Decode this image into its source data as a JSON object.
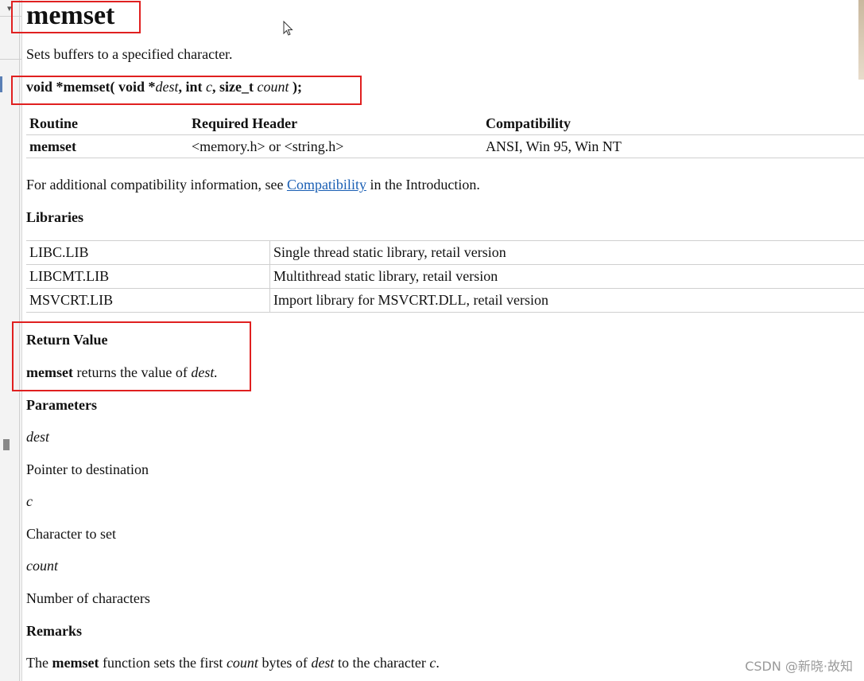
{
  "title": "memset",
  "description": "Sets buffers to a specified character.",
  "prototype": {
    "p1": "void *memset( void *",
    "dest": "dest",
    "p2": ", int ",
    "c": "c",
    "p3": ", size_t ",
    "count": "count",
    "p4": " );"
  },
  "compat_table": {
    "headers": [
      "Routine",
      "Required Header",
      "Compatibility"
    ],
    "row": [
      "memset",
      "<memory.h> or <string.h>",
      "ANSI, Win 95, Win NT"
    ]
  },
  "additional": {
    "before": "For additional compatibility information, see ",
    "link": "Compatibility",
    "after": " in the Introduction."
  },
  "libraries": {
    "heading": "Libraries",
    "rows": [
      [
        "LIBC.LIB",
        "Single thread static library, retail version"
      ],
      [
        "LIBCMT.LIB",
        "Multithread static library, retail version"
      ],
      [
        "MSVCRT.LIB",
        "Import library for MSVCRT.DLL, retail version"
      ]
    ]
  },
  "return_value": {
    "heading": "Return Value",
    "name": "memset",
    "text": " returns the value of ",
    "param": "dest."
  },
  "parameters": {
    "heading": "Parameters",
    "items": [
      {
        "name": "dest",
        "desc": "Pointer to destination"
      },
      {
        "name": "c",
        "desc": "Character to set"
      },
      {
        "name": "count",
        "desc": "Number of characters"
      }
    ]
  },
  "remarks": {
    "heading": "Remarks",
    "t1": "The ",
    "fn": "memset",
    "t2": " function sets the first ",
    "count": "count",
    "t3": " bytes of ",
    "dest": "dest",
    "t4": " to the character ",
    "c": "c",
    "t5": "."
  },
  "watermark": "CSDN @新晓·故知",
  "colors": {
    "highlight_box": "#e02020",
    "link": "#1a5fb4"
  }
}
